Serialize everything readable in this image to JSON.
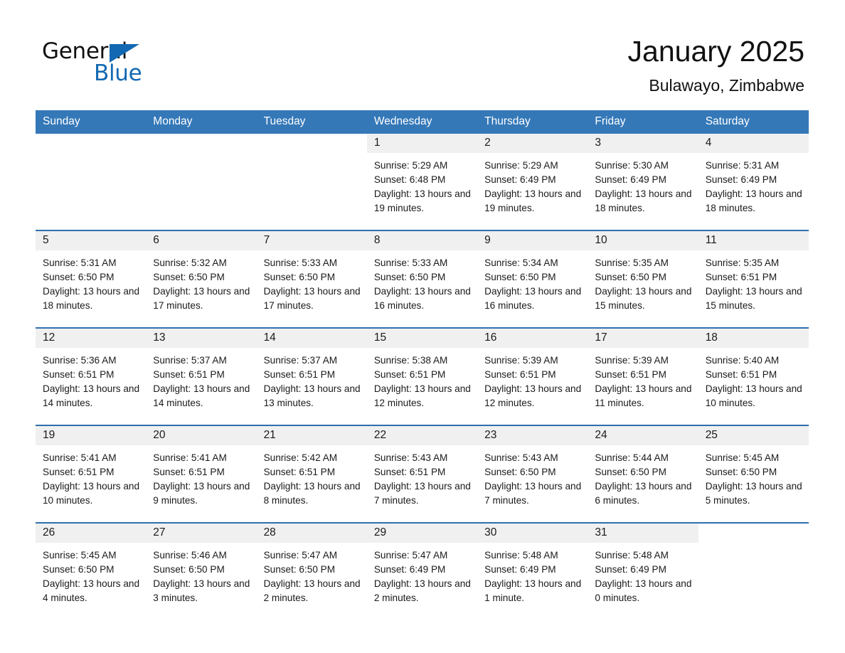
{
  "brand": {
    "word_one": "General",
    "word_two": "Blue",
    "triangle_color": "#1268b3",
    "logo_name": "general-blue-logo"
  },
  "header": {
    "title": "January 2025",
    "subtitle": "Bulawayo, Zimbabwe"
  },
  "theme": {
    "header_blue": "#3478b8",
    "row_divider_blue": "#2f6fae",
    "daynum_band": "#f0f0f0",
    "text": "#1a1a1a"
  },
  "calendar": {
    "weekday_headers": [
      "Sunday",
      "Monday",
      "Tuesday",
      "Wednesday",
      "Thursday",
      "Friday",
      "Saturday"
    ],
    "weeks": [
      [
        {
          "day": "",
          "blank": true,
          "lines": []
        },
        {
          "day": "",
          "blank": true,
          "lines": []
        },
        {
          "day": "",
          "blank": true,
          "lines": []
        },
        {
          "day": "1",
          "lines": [
            "Sunrise: 5:29 AM",
            "Sunset: 6:48 PM",
            "Daylight: 13 hours and 19 minutes."
          ]
        },
        {
          "day": "2",
          "lines": [
            "Sunrise: 5:29 AM",
            "Sunset: 6:49 PM",
            "Daylight: 13 hours and 19 minutes."
          ]
        },
        {
          "day": "3",
          "lines": [
            "Sunrise: 5:30 AM",
            "Sunset: 6:49 PM",
            "Daylight: 13 hours and 18 minutes."
          ]
        },
        {
          "day": "4",
          "lines": [
            "Sunrise: 5:31 AM",
            "Sunset: 6:49 PM",
            "Daylight: 13 hours and 18 minutes."
          ]
        }
      ],
      [
        {
          "day": "5",
          "lines": [
            "Sunrise: 5:31 AM",
            "Sunset: 6:50 PM",
            "Daylight: 13 hours and 18 minutes."
          ]
        },
        {
          "day": "6",
          "lines": [
            "Sunrise: 5:32 AM",
            "Sunset: 6:50 PM",
            "Daylight: 13 hours and 17 minutes."
          ]
        },
        {
          "day": "7",
          "lines": [
            "Sunrise: 5:33 AM",
            "Sunset: 6:50 PM",
            "Daylight: 13 hours and 17 minutes."
          ]
        },
        {
          "day": "8",
          "lines": [
            "Sunrise: 5:33 AM",
            "Sunset: 6:50 PM",
            "Daylight: 13 hours and 16 minutes."
          ]
        },
        {
          "day": "9",
          "lines": [
            "Sunrise: 5:34 AM",
            "Sunset: 6:50 PM",
            "Daylight: 13 hours and 16 minutes."
          ]
        },
        {
          "day": "10",
          "lines": [
            "Sunrise: 5:35 AM",
            "Sunset: 6:50 PM",
            "Daylight: 13 hours and 15 minutes."
          ]
        },
        {
          "day": "11",
          "lines": [
            "Sunrise: 5:35 AM",
            "Sunset: 6:51 PM",
            "Daylight: 13 hours and 15 minutes."
          ]
        }
      ],
      [
        {
          "day": "12",
          "lines": [
            "Sunrise: 5:36 AM",
            "Sunset: 6:51 PM",
            "Daylight: 13 hours and 14 minutes."
          ]
        },
        {
          "day": "13",
          "lines": [
            "Sunrise: 5:37 AM",
            "Sunset: 6:51 PM",
            "Daylight: 13 hours and 14 minutes."
          ]
        },
        {
          "day": "14",
          "lines": [
            "Sunrise: 5:37 AM",
            "Sunset: 6:51 PM",
            "Daylight: 13 hours and 13 minutes."
          ]
        },
        {
          "day": "15",
          "lines": [
            "Sunrise: 5:38 AM",
            "Sunset: 6:51 PM",
            "Daylight: 13 hours and 12 minutes."
          ]
        },
        {
          "day": "16",
          "lines": [
            "Sunrise: 5:39 AM",
            "Sunset: 6:51 PM",
            "Daylight: 13 hours and 12 minutes."
          ]
        },
        {
          "day": "17",
          "lines": [
            "Sunrise: 5:39 AM",
            "Sunset: 6:51 PM",
            "Daylight: 13 hours and 11 minutes."
          ]
        },
        {
          "day": "18",
          "lines": [
            "Sunrise: 5:40 AM",
            "Sunset: 6:51 PM",
            "Daylight: 13 hours and 10 minutes."
          ]
        }
      ],
      [
        {
          "day": "19",
          "lines": [
            "Sunrise: 5:41 AM",
            "Sunset: 6:51 PM",
            "Daylight: 13 hours and 10 minutes."
          ]
        },
        {
          "day": "20",
          "lines": [
            "Sunrise: 5:41 AM",
            "Sunset: 6:51 PM",
            "Daylight: 13 hours and 9 minutes."
          ]
        },
        {
          "day": "21",
          "lines": [
            "Sunrise: 5:42 AM",
            "Sunset: 6:51 PM",
            "Daylight: 13 hours and 8 minutes."
          ]
        },
        {
          "day": "22",
          "lines": [
            "Sunrise: 5:43 AM",
            "Sunset: 6:51 PM",
            "Daylight: 13 hours and 7 minutes."
          ]
        },
        {
          "day": "23",
          "lines": [
            "Sunrise: 5:43 AM",
            "Sunset: 6:50 PM",
            "Daylight: 13 hours and 7 minutes."
          ]
        },
        {
          "day": "24",
          "lines": [
            "Sunrise: 5:44 AM",
            "Sunset: 6:50 PM",
            "Daylight: 13 hours and 6 minutes."
          ]
        },
        {
          "day": "25",
          "lines": [
            "Sunrise: 5:45 AM",
            "Sunset: 6:50 PM",
            "Daylight: 13 hours and 5 minutes."
          ]
        }
      ],
      [
        {
          "day": "26",
          "lines": [
            "Sunrise: 5:45 AM",
            "Sunset: 6:50 PM",
            "Daylight: 13 hours and 4 minutes."
          ]
        },
        {
          "day": "27",
          "lines": [
            "Sunrise: 5:46 AM",
            "Sunset: 6:50 PM",
            "Daylight: 13 hours and 3 minutes."
          ]
        },
        {
          "day": "28",
          "lines": [
            "Sunrise: 5:47 AM",
            "Sunset: 6:50 PM",
            "Daylight: 13 hours and 2 minutes."
          ]
        },
        {
          "day": "29",
          "lines": [
            "Sunrise: 5:47 AM",
            "Sunset: 6:49 PM",
            "Daylight: 13 hours and 2 minutes."
          ]
        },
        {
          "day": "30",
          "lines": [
            "Sunrise: 5:48 AM",
            "Sunset: 6:49 PM",
            "Daylight: 13 hours and 1 minute."
          ]
        },
        {
          "day": "31",
          "lines": [
            "Sunrise: 5:48 AM",
            "Sunset: 6:49 PM",
            "Daylight: 13 hours and 0 minutes."
          ]
        },
        {
          "day": "",
          "blank": true,
          "lines": []
        }
      ]
    ]
  }
}
